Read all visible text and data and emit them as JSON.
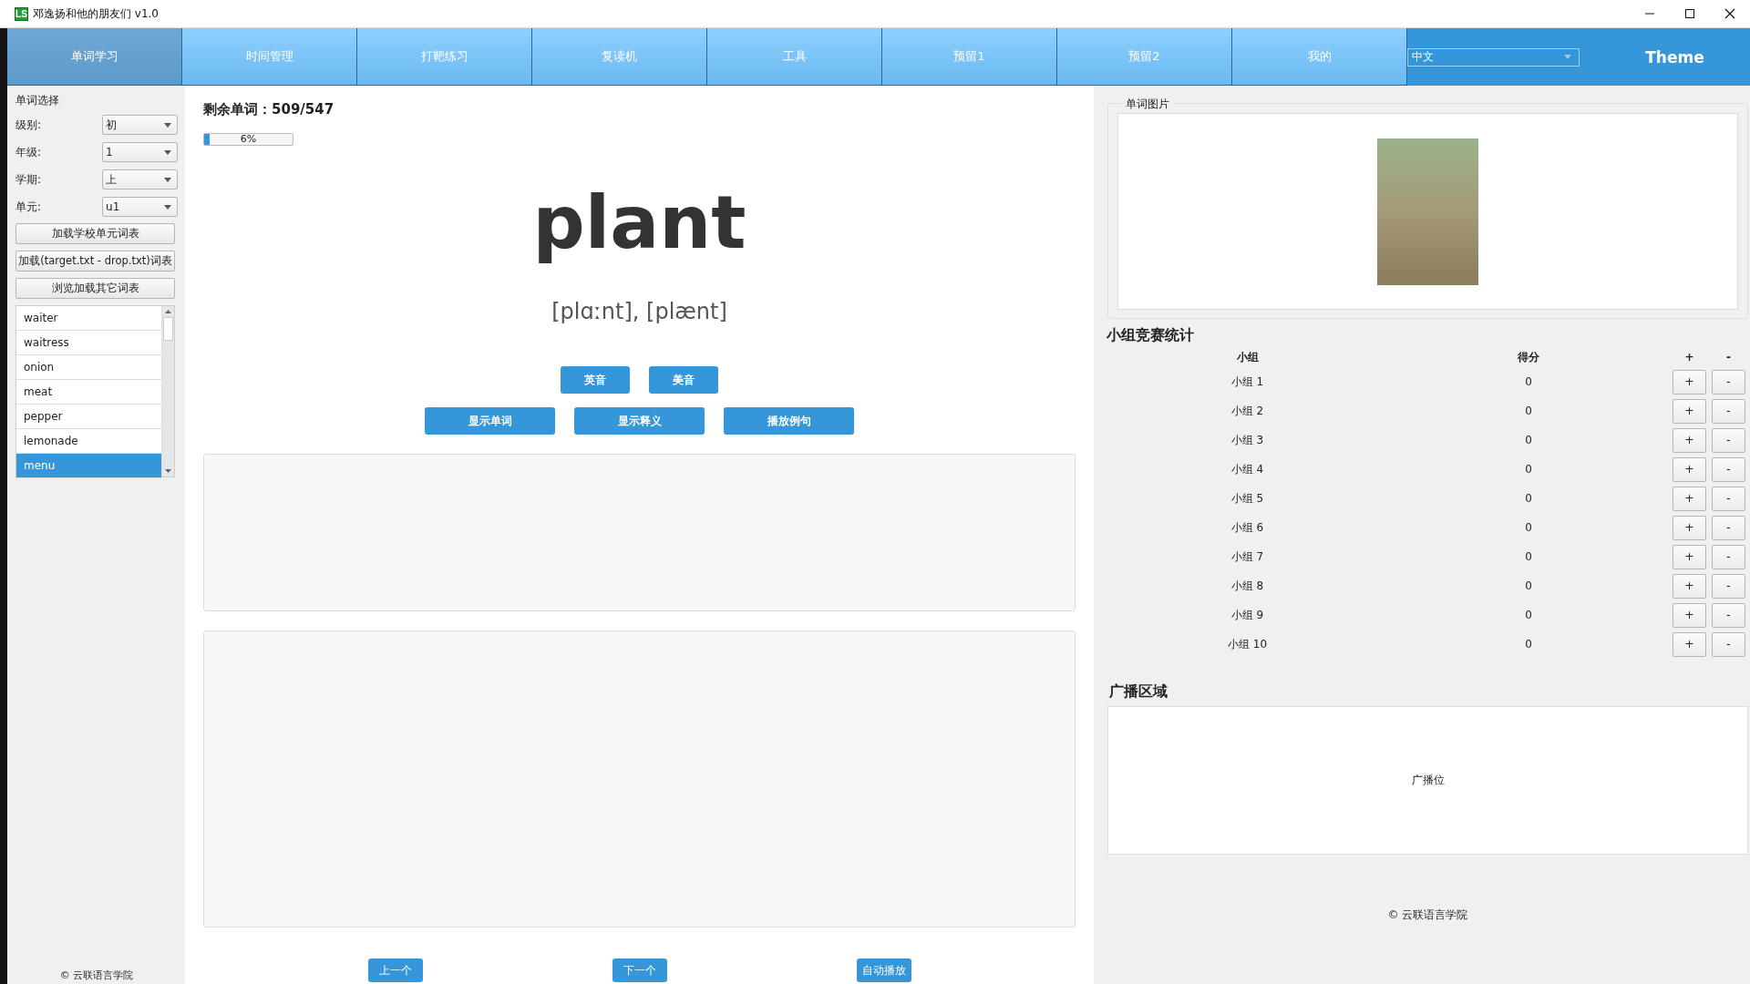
{
  "window": {
    "title": "邓逸扬和他的朋友们 v1.0",
    "app_icon_text": "LS"
  },
  "nav": {
    "tabs": [
      {
        "label": "单词学习",
        "selected": true
      },
      {
        "label": "时间管理",
        "selected": false
      },
      {
        "label": "打靶练习",
        "selected": false
      },
      {
        "label": "复读机",
        "selected": false
      },
      {
        "label": "工具",
        "selected": false
      },
      {
        "label": "预留1",
        "selected": false
      },
      {
        "label": "预留2",
        "selected": false
      },
      {
        "label": "我的",
        "selected": false
      }
    ],
    "language_select": "中文",
    "theme_label": "Theme"
  },
  "sidebar": {
    "title": "单词选择",
    "filters": [
      {
        "label": "级别:",
        "value": "初"
      },
      {
        "label": "年级:",
        "value": "1"
      },
      {
        "label": "学期:",
        "value": "上"
      },
      {
        "label": "单元:",
        "value": "u1"
      }
    ],
    "buttons": [
      "加载学校单元词表",
      "加载(target.txt - drop.txt)词表",
      "浏览加载其它词表"
    ],
    "word_list": [
      {
        "label": "waiter",
        "selected": false
      },
      {
        "label": "waitress",
        "selected": false
      },
      {
        "label": "onion",
        "selected": false
      },
      {
        "label": "meat",
        "selected": false
      },
      {
        "label": "pepper",
        "selected": false
      },
      {
        "label": "lemonade",
        "selected": false
      },
      {
        "label": "menu",
        "selected": true
      }
    ],
    "footer": "© 云联语言学院"
  },
  "main": {
    "remaining": "剩余单词：509/547",
    "progress": {
      "level": 0.06,
      "text": "6%"
    },
    "word": "plant",
    "phonetic": "[plɑːnt], [plænt]",
    "pronunciation_buttons": [
      "英音",
      "美音"
    ],
    "action_buttons": [
      "显示单词",
      "显示释义",
      "播放例句"
    ],
    "nav_buttons": [
      "上一个",
      "下一个",
      "自动播放"
    ]
  },
  "right": {
    "picture_title": "单词图片",
    "scoreboard": {
      "title": "小组竞赛统计",
      "columns": [
        "小组",
        "得分",
        "+",
        "-"
      ],
      "rows": [
        {
          "group": "小组 1",
          "score": "0",
          "plus": "+",
          "minus": "-"
        },
        {
          "group": "小组 2",
          "score": "0",
          "plus": "+",
          "minus": "-"
        },
        {
          "group": "小组 3",
          "score": "0",
          "plus": "+",
          "minus": "-"
        },
        {
          "group": "小组 4",
          "score": "0",
          "plus": "+",
          "minus": "-"
        },
        {
          "group": "小组 5",
          "score": "0",
          "plus": "+",
          "minus": "-"
        },
        {
          "group": "小组 6",
          "score": "0",
          "plus": "+",
          "minus": "-"
        },
        {
          "group": "小组 7",
          "score": "0",
          "plus": "+",
          "minus": "-"
        },
        {
          "group": "小组 8",
          "score": "0",
          "plus": "+",
          "minus": "-"
        },
        {
          "group": "小组 9",
          "score": "0",
          "plus": "+",
          "minus": "-"
        },
        {
          "group": "小组 10",
          "score": "0",
          "plus": "+",
          "minus": "-"
        }
      ]
    },
    "broadcast": {
      "title": "广播区域",
      "text": "广播位"
    },
    "footer": "© 云联语言学院"
  }
}
